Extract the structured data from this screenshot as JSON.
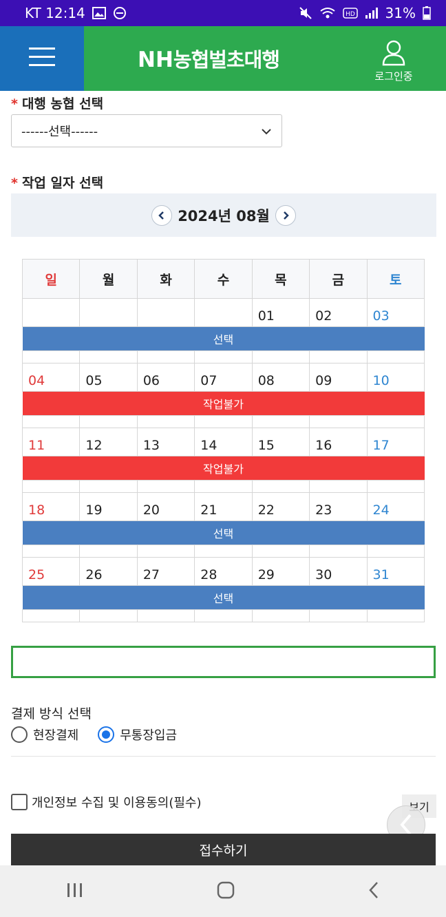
{
  "status_bar": {
    "carrier_time": "KT 12:14",
    "battery": "31%"
  },
  "header": {
    "logo_nh": "NH",
    "logo_text": "농협벌초대행",
    "login_label": "로그인중"
  },
  "form": {
    "agency_label": "대행 농협 선택",
    "agency_select_value": "------선택------",
    "date_label": "작업 일자 선택",
    "required_mark": "*",
    "month_title": "2024년 08월",
    "payment_label": "결제 방식 선택",
    "payment_options": [
      {
        "label": "현장결제",
        "selected": false
      },
      {
        "label": "무통장입금",
        "selected": true
      }
    ],
    "agree_label": "개인정보 수집 및 이용동의(필수)",
    "view_button": "보기",
    "submit_button": "접수하기"
  },
  "calendar": {
    "weekdays": [
      "일",
      "월",
      "화",
      "수",
      "목",
      "금",
      "토"
    ],
    "weeks": [
      {
        "days": [
          "",
          "",
          "",
          "",
          "01",
          "02",
          "03"
        ],
        "status": "선택"
      },
      {
        "days": [
          "04",
          "05",
          "06",
          "07",
          "08",
          "09",
          "10"
        ],
        "status": "작업불가"
      },
      {
        "days": [
          "11",
          "12",
          "13",
          "14",
          "15",
          "16",
          "17"
        ],
        "status": "작업불가"
      },
      {
        "days": [
          "18",
          "19",
          "20",
          "21",
          "22",
          "23",
          "24"
        ],
        "status": "선택"
      },
      {
        "days": [
          "25",
          "26",
          "27",
          "28",
          "29",
          "30",
          "31"
        ],
        "status": "선택"
      }
    ]
  },
  "colors": {
    "header_green": "#2daa4f",
    "menu_blue": "#1a6fba",
    "status_purple": "#3c0fb4",
    "select_bar": "#4a7fc1",
    "unavailable_bar": "#f23a3a",
    "sunday": "#e03a3a",
    "saturday": "#2f86d1"
  }
}
